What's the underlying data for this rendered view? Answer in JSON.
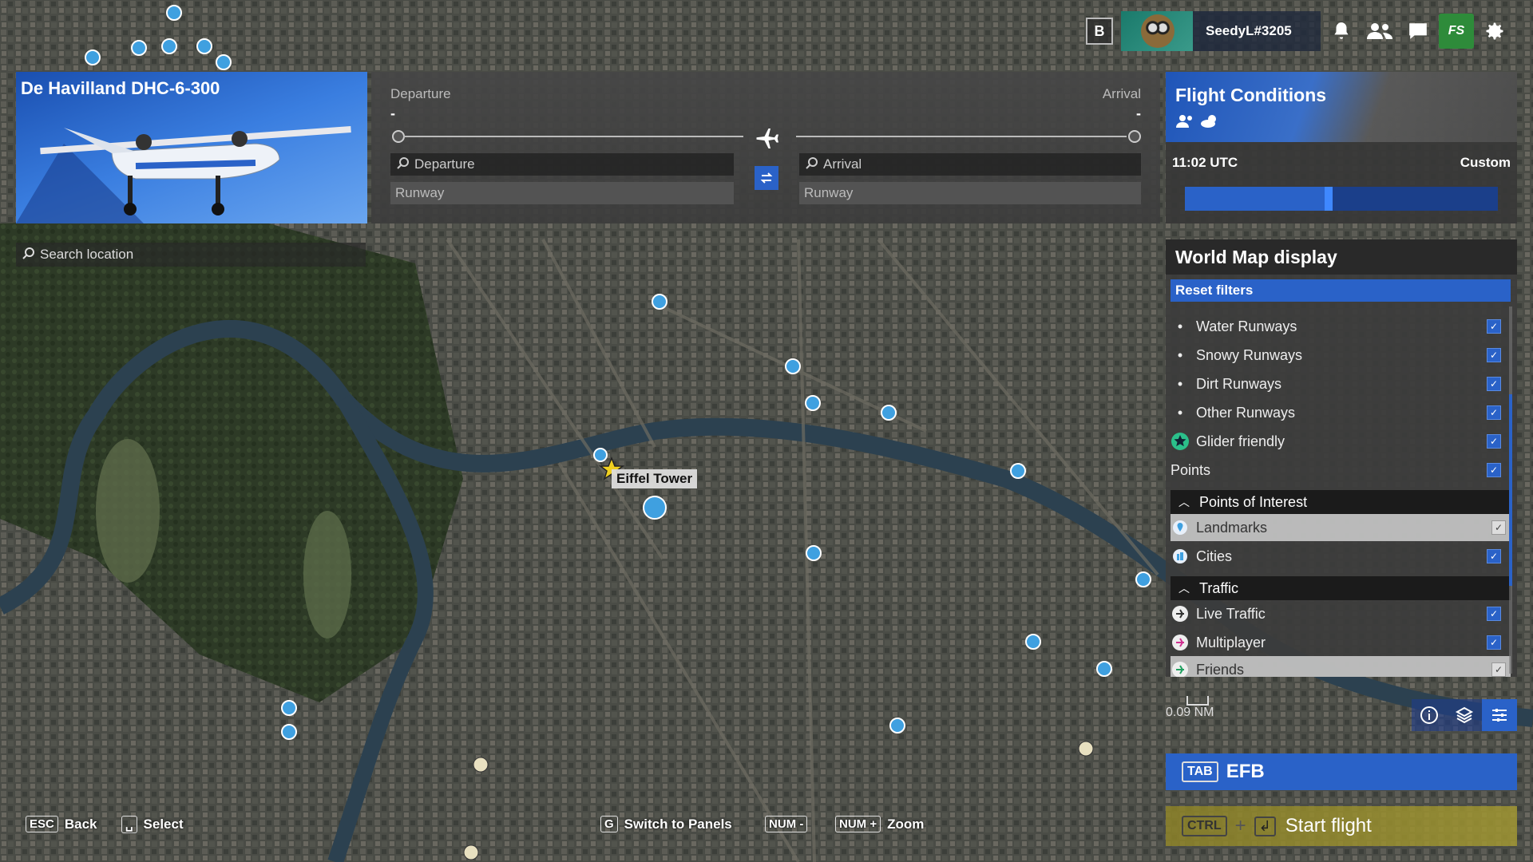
{
  "topbar": {
    "b_key": "B",
    "username": "SeedyL#3205",
    "fs_label": "FS"
  },
  "aircraft": {
    "name": "De Havilland DHC-6-300"
  },
  "search_location": {
    "placeholder": "Search location"
  },
  "flight_plan": {
    "departure_label": "Departure",
    "arrival_label": "Arrival",
    "departure_value": "-",
    "arrival_value": "-",
    "departure_field": "Departure",
    "arrival_field": "Arrival",
    "departure_runway": "Runway",
    "arrival_runway": "Runway"
  },
  "conditions": {
    "title": "Flight Conditions",
    "time": "11:02 UTC",
    "mode": "Custom",
    "time_progress": 0.46
  },
  "world_map_display": {
    "title": "World Map display",
    "reset": "Reset filters",
    "rows": [
      {
        "label": "Water Runways",
        "icon": "bullet",
        "checked": true
      },
      {
        "label": "Snowy Runways",
        "icon": "bullet",
        "checked": true
      },
      {
        "label": "Dirt Runways",
        "icon": "bullet",
        "checked": true
      },
      {
        "label": "Other Runways",
        "icon": "bullet",
        "checked": true
      },
      {
        "label": "Glider friendly",
        "icon": "glider-star-icon",
        "checked": true
      },
      {
        "label": "Points",
        "icon": "none",
        "checked": true
      }
    ],
    "group_poi": "Points of Interest",
    "poi_rows": [
      {
        "label": "Landmarks",
        "icon": "landmark-pin-icon",
        "checked": true
      },
      {
        "label": "Cities",
        "icon": "city-icon",
        "checked": true
      }
    ],
    "group_traffic": "Traffic",
    "traffic_rows": [
      {
        "label": "Live Traffic",
        "icon": "plane-icon",
        "checked": true
      },
      {
        "label": "Multiplayer",
        "icon": "plane-pink-icon",
        "checked": true
      },
      {
        "label": "Friends",
        "icon": "plane-green-icon",
        "checked": true
      }
    ]
  },
  "scale": {
    "value": "0.09 NM"
  },
  "efb": {
    "key": "TAB",
    "label": "EFB"
  },
  "start_flight": {
    "key": "CTRL",
    "plus": "+",
    "label": "Start flight"
  },
  "hints": [
    {
      "key": "ESC",
      "label": "Back"
    },
    {
      "key": "␣",
      "label": "Select"
    },
    {
      "key": "G",
      "label": "Switch to Panels"
    },
    {
      "key": "NUM -",
      "label": ""
    },
    {
      "key": "NUM +",
      "label": "Zoom"
    }
  ],
  "map": {
    "landmark_label": "Eiffel Tower"
  },
  "colors": {
    "accent": "#2a62c8",
    "start": "#a09632",
    "fs_green": "#2e8b3a"
  }
}
